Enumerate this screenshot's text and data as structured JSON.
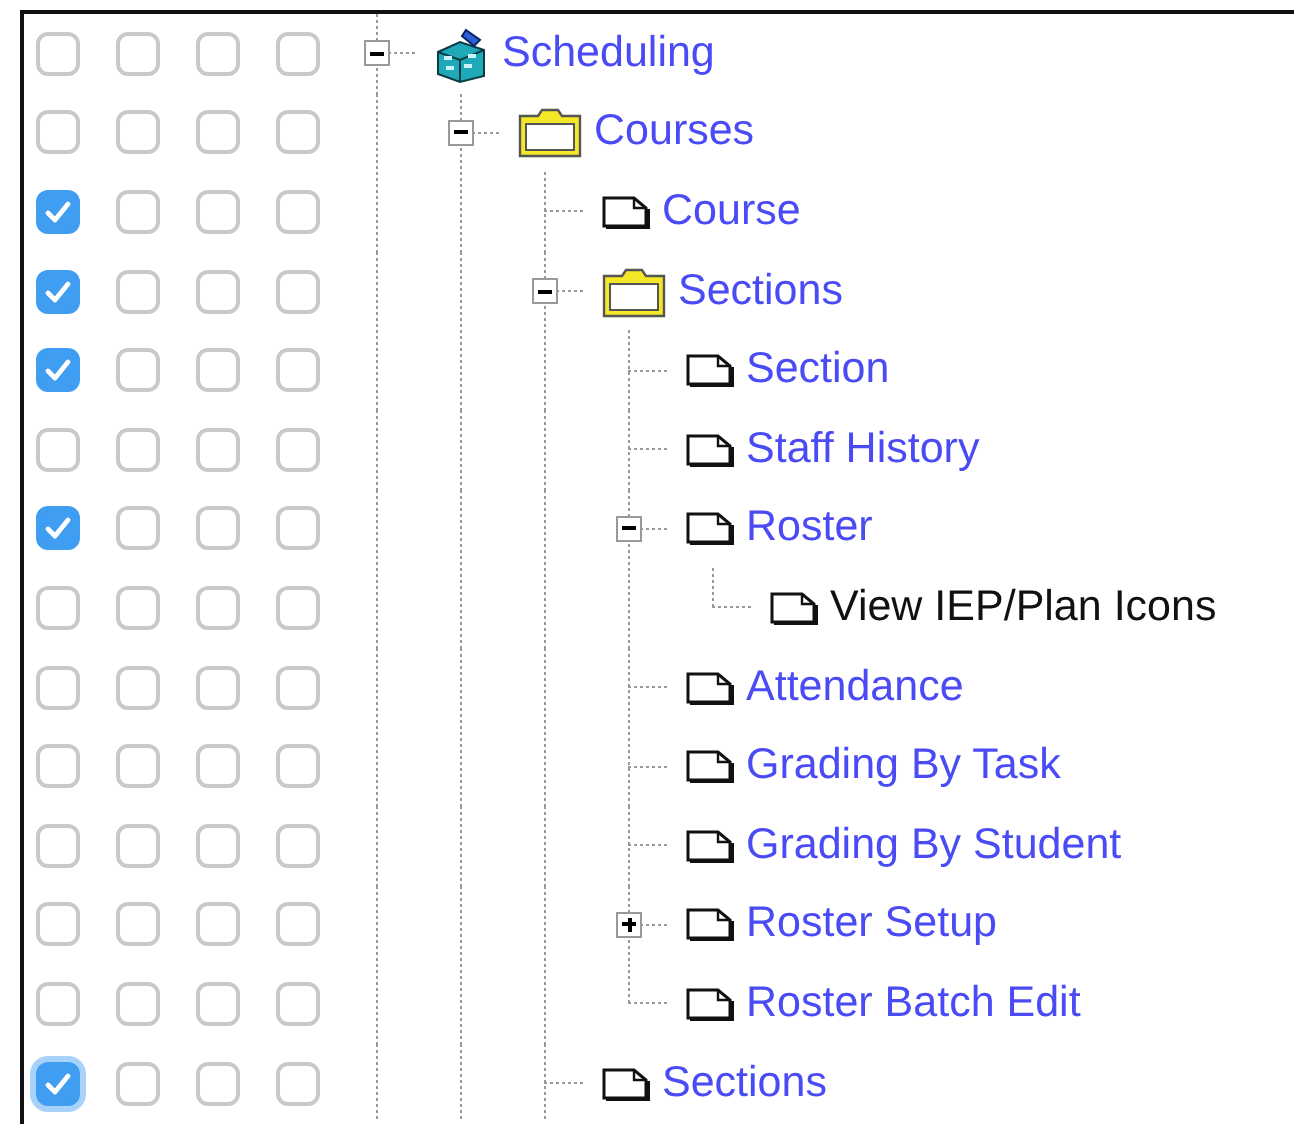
{
  "tree": [
    {
      "label": "Scheduling",
      "kind": "module",
      "link": true,
      "expanded": true,
      "checks": [
        false,
        false,
        false,
        false
      ],
      "focused": false,
      "children": [
        {
          "label": "Courses",
          "kind": "folder",
          "link": true,
          "expanded": true,
          "checks": [
            false,
            false,
            false,
            false
          ],
          "focused": false,
          "children": [
            {
              "label": "Course",
              "kind": "page",
              "link": true,
              "checks": [
                true,
                false,
                false,
                false
              ],
              "focused": false
            },
            {
              "label": "Sections",
              "kind": "folder",
              "link": true,
              "expanded": true,
              "checks": [
                true,
                false,
                false,
                false
              ],
              "focused": false,
              "children": [
                {
                  "label": "Section",
                  "kind": "page",
                  "link": true,
                  "checks": [
                    true,
                    false,
                    false,
                    false
                  ],
                  "focused": false
                },
                {
                  "label": "Staff History",
                  "kind": "page",
                  "link": true,
                  "checks": [
                    false,
                    false,
                    false,
                    false
                  ],
                  "focused": false
                },
                {
                  "label": "Roster",
                  "kind": "page",
                  "link": true,
                  "expanded": true,
                  "checks": [
                    true,
                    false,
                    false,
                    false
                  ],
                  "focused": false,
                  "children": [
                    {
                      "label": "View IEP/Plan Icons",
                      "kind": "page",
                      "link": false,
                      "checks": [
                        false,
                        false,
                        false,
                        false
                      ],
                      "focused": false
                    }
                  ]
                },
                {
                  "label": "Attendance",
                  "kind": "page",
                  "link": true,
                  "checks": [
                    false,
                    false,
                    false,
                    false
                  ],
                  "focused": false
                },
                {
                  "label": "Grading By Task",
                  "kind": "page",
                  "link": true,
                  "checks": [
                    false,
                    false,
                    false,
                    false
                  ],
                  "focused": false
                },
                {
                  "label": "Grading By Student",
                  "kind": "page",
                  "link": true,
                  "checks": [
                    false,
                    false,
                    false,
                    false
                  ],
                  "focused": false
                },
                {
                  "label": "Roster Setup",
                  "kind": "page",
                  "link": true,
                  "expanded": false,
                  "checks": [
                    false,
                    false,
                    false,
                    false
                  ],
                  "focused": false
                },
                {
                  "label": "Roster Batch Edit",
                  "kind": "page",
                  "link": true,
                  "checks": [
                    false,
                    false,
                    false,
                    false
                  ],
                  "focused": false
                }
              ]
            },
            {
              "label": "Sections",
              "kind": "page",
              "link": true,
              "checks": [
                true,
                false,
                false,
                false
              ],
              "focused": true
            }
          ]
        }
      ]
    }
  ]
}
